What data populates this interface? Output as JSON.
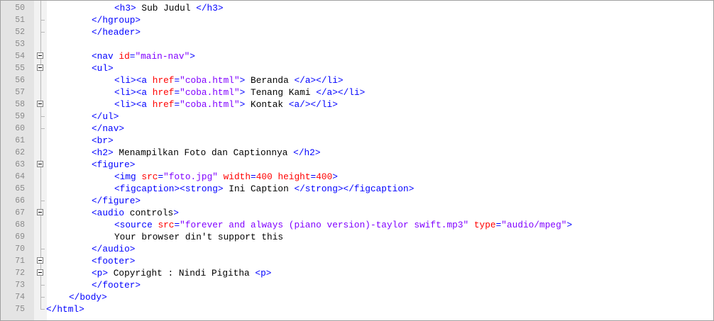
{
  "editor": {
    "lines": [
      {
        "num": "50",
        "indent": 3,
        "fold": "none",
        "tokens": [
          [
            "tag",
            "<h3>"
          ],
          [
            "text",
            " Sub Judul "
          ],
          [
            "tag",
            "</h3>"
          ]
        ]
      },
      {
        "num": "51",
        "indent": 2,
        "fold": "end",
        "tokens": [
          [
            "tag",
            "</hgroup>"
          ]
        ]
      },
      {
        "num": "52",
        "indent": 2,
        "fold": "end",
        "tokens": [
          [
            "tag",
            "</header>"
          ]
        ]
      },
      {
        "num": "53",
        "indent": 0,
        "fold": "none",
        "tokens": []
      },
      {
        "num": "54",
        "indent": 2,
        "fold": "box",
        "tokens": [
          [
            "tag",
            "<nav "
          ],
          [
            "attr",
            "id"
          ],
          [
            "tag",
            "="
          ],
          [
            "str",
            "\"main-nav\""
          ],
          [
            "tag",
            ">"
          ]
        ]
      },
      {
        "num": "55",
        "indent": 2,
        "fold": "box",
        "tokens": [
          [
            "tag",
            "<ul>"
          ]
        ]
      },
      {
        "num": "56",
        "indent": 3,
        "fold": "none",
        "tokens": [
          [
            "tag",
            "<li><a "
          ],
          [
            "attr",
            "href"
          ],
          [
            "tag",
            "="
          ],
          [
            "str",
            "\"coba.html\""
          ],
          [
            "tag",
            ">"
          ],
          [
            "text",
            " Beranda "
          ],
          [
            "tag",
            "</a></li>"
          ]
        ]
      },
      {
        "num": "57",
        "indent": 3,
        "fold": "none",
        "tokens": [
          [
            "tag",
            "<li><a "
          ],
          [
            "attr",
            "href"
          ],
          [
            "tag",
            "="
          ],
          [
            "str",
            "\"coba.html\""
          ],
          [
            "tag",
            ">"
          ],
          [
            "text",
            " Tenang Kami "
          ],
          [
            "tag",
            "</a></li>"
          ]
        ]
      },
      {
        "num": "58",
        "indent": 3,
        "fold": "box",
        "tokens": [
          [
            "tag",
            "<li><a "
          ],
          [
            "attr",
            "href"
          ],
          [
            "tag",
            "="
          ],
          [
            "str",
            "\"coba.html\""
          ],
          [
            "tag",
            ">"
          ],
          [
            "text",
            " Kontak "
          ],
          [
            "tag",
            "<a/></li>"
          ]
        ]
      },
      {
        "num": "59",
        "indent": 2,
        "fold": "end",
        "tokens": [
          [
            "tag",
            "</ul>"
          ]
        ]
      },
      {
        "num": "60",
        "indent": 2,
        "fold": "end",
        "tokens": [
          [
            "tag",
            "</nav>"
          ]
        ]
      },
      {
        "num": "61",
        "indent": 2,
        "fold": "none",
        "tokens": [
          [
            "tag",
            "<br>"
          ]
        ]
      },
      {
        "num": "62",
        "indent": 2,
        "fold": "none",
        "tokens": [
          [
            "tag",
            "<h2>"
          ],
          [
            "text",
            " Menampilkan Foto dan Captionnya "
          ],
          [
            "tag",
            "</h2>"
          ]
        ]
      },
      {
        "num": "63",
        "indent": 2,
        "fold": "box",
        "tokens": [
          [
            "tag",
            "<figure>"
          ]
        ]
      },
      {
        "num": "64",
        "indent": 3,
        "fold": "none",
        "tokens": [
          [
            "tag",
            "<img "
          ],
          [
            "attr",
            "src"
          ],
          [
            "tag",
            "="
          ],
          [
            "str",
            "\"foto.jpg\""
          ],
          [
            "tag",
            " "
          ],
          [
            "attr",
            "width"
          ],
          [
            "tag",
            "="
          ],
          [
            "attr",
            "400"
          ],
          [
            "tag",
            " "
          ],
          [
            "attr",
            "height"
          ],
          [
            "tag",
            "="
          ],
          [
            "attr",
            "400"
          ],
          [
            "tag",
            ">"
          ]
        ]
      },
      {
        "num": "65",
        "indent": 3,
        "fold": "none",
        "tokens": [
          [
            "tag",
            "<figcaption><strong>"
          ],
          [
            "text",
            " Ini Caption "
          ],
          [
            "tag",
            "</strong></figcaption>"
          ]
        ]
      },
      {
        "num": "66",
        "indent": 2,
        "fold": "end",
        "tokens": [
          [
            "tag",
            "</figure>"
          ]
        ]
      },
      {
        "num": "67",
        "indent": 2,
        "fold": "box",
        "tokens": [
          [
            "tag",
            "<audio "
          ],
          [
            "text",
            "controls"
          ],
          [
            "tag",
            ">"
          ]
        ]
      },
      {
        "num": "68",
        "indent": 3,
        "fold": "none",
        "tokens": [
          [
            "tag",
            "<source "
          ],
          [
            "attr",
            "src"
          ],
          [
            "tag",
            "="
          ],
          [
            "str",
            "\"forever and always (piano version)-taylor swift.mp3\""
          ],
          [
            "tag",
            " "
          ],
          [
            "attr",
            "type"
          ],
          [
            "tag",
            "="
          ],
          [
            "str",
            "\"audio/mpeg\""
          ],
          [
            "tag",
            ">"
          ]
        ]
      },
      {
        "num": "69",
        "indent": 3,
        "fold": "none",
        "tokens": [
          [
            "text",
            "Your browser din't support this"
          ]
        ]
      },
      {
        "num": "70",
        "indent": 2,
        "fold": "end",
        "tokens": [
          [
            "tag",
            "</audio>"
          ]
        ]
      },
      {
        "num": "71",
        "indent": 2,
        "fold": "box",
        "tokens": [
          [
            "tag",
            "<footer>"
          ]
        ]
      },
      {
        "num": "72",
        "indent": 2,
        "fold": "box",
        "tokens": [
          [
            "tag",
            "<p>"
          ],
          [
            "text",
            " Copyright : Nindi Pigitha "
          ],
          [
            "tag",
            "<p>"
          ]
        ]
      },
      {
        "num": "73",
        "indent": 2,
        "fold": "end",
        "tokens": [
          [
            "tag",
            "</footer>"
          ]
        ]
      },
      {
        "num": "74",
        "indent": 1,
        "fold": "end",
        "tokens": [
          [
            "tag",
            "</body>"
          ]
        ]
      },
      {
        "num": "75",
        "indent": 0,
        "fold": "end",
        "tokens": [
          [
            "tag",
            "</html>"
          ]
        ]
      }
    ]
  }
}
